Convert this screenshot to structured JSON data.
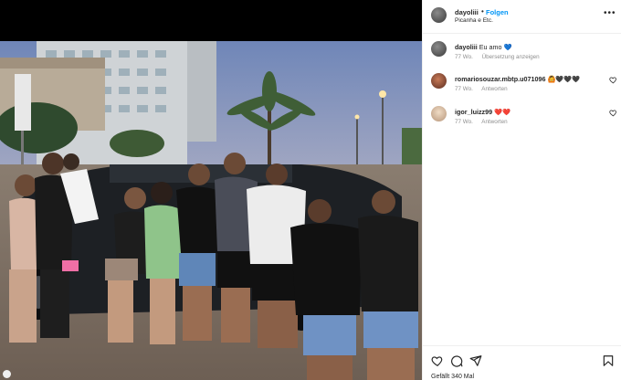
{
  "post": {
    "username": "dayoliii",
    "separator": "•",
    "follow_label": "Folgen",
    "location": "Picanha e Etc.",
    "more_label": "•••"
  },
  "comments": [
    {
      "username": "dayoliii",
      "text": "Eu amo",
      "emoji": "💙",
      "age": "77 Wo.",
      "action": "Übersetzung anzeigen"
    },
    {
      "username": "romariosouzar.mbtp.u071096",
      "text": "",
      "emoji": "🙆🖤🖤🖤",
      "age": "77 Wo.",
      "action": "Antworten"
    },
    {
      "username": "igor_luizz99",
      "text": "",
      "emoji": "❤️❤️",
      "age": "77 Wo.",
      "action": "Antworten"
    }
  ],
  "footer": {
    "likes_text": "Gefällt 340 Mal"
  },
  "colors": {
    "follow_blue": "#0095f6",
    "meta_gray": "#8e8e8e",
    "divider": "#efefef"
  },
  "icons": [
    "heart-icon",
    "comment-icon",
    "share-icon",
    "bookmark-icon",
    "more-icon"
  ]
}
